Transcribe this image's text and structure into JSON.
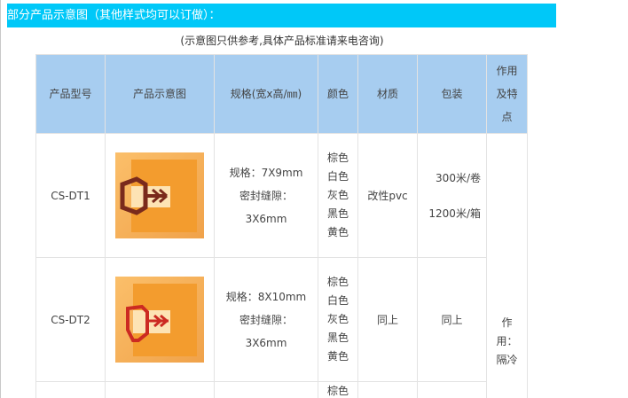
{
  "banner": {
    "text": "部分产品示意图（其他样式均可以订做）："
  },
  "subtitle": "(示意图只供参考,具体产品标准请来电咨询)",
  "colors": {
    "banner_bg": "#00c8f8",
    "header_bg": "#a7cdf0",
    "grid_line": "#e3e3e3",
    "product_wood": "#f39c2e",
    "seal_dark": "#7a2a1c",
    "seal_red": "#cc2a22"
  },
  "table": {
    "headers": {
      "model": "产品型号",
      "image": "产品示意图",
      "spec": "规格(宽x高/㎜)",
      "color": "颜色",
      "material": "材质",
      "packing": "包装",
      "feature_1": "作用",
      "feature_2": "及特",
      "feature_3": "点"
    },
    "rows": [
      {
        "model": "CS-DT1",
        "image_icon": "seal-strip-profile-dt1-icon",
        "spec_1": "规格：7X9mm",
        "spec_2": "密封缝隙：",
        "spec_3": "3X6mm",
        "colors": [
          "棕色",
          "白色",
          "灰色",
          "黑色",
          "黄色"
        ],
        "material": "改性pvc",
        "packing_1": "300米/卷",
        "packing_2": "1200米/箱"
      },
      {
        "model": "CS-DT2",
        "image_icon": "seal-strip-profile-dt2-icon",
        "spec_1": "规格：8X10mm",
        "spec_2": "密封缝隙：",
        "spec_3": "3X6mm",
        "colors": [
          "棕色",
          "白色",
          "灰色",
          "黑色",
          "黄色"
        ],
        "material": "同上",
        "packing": "同上"
      },
      {
        "colors_partial": "棕色"
      }
    ],
    "feature": {
      "line_1": "作",
      "line_2": "用：",
      "line_3": "隔冷"
    }
  }
}
